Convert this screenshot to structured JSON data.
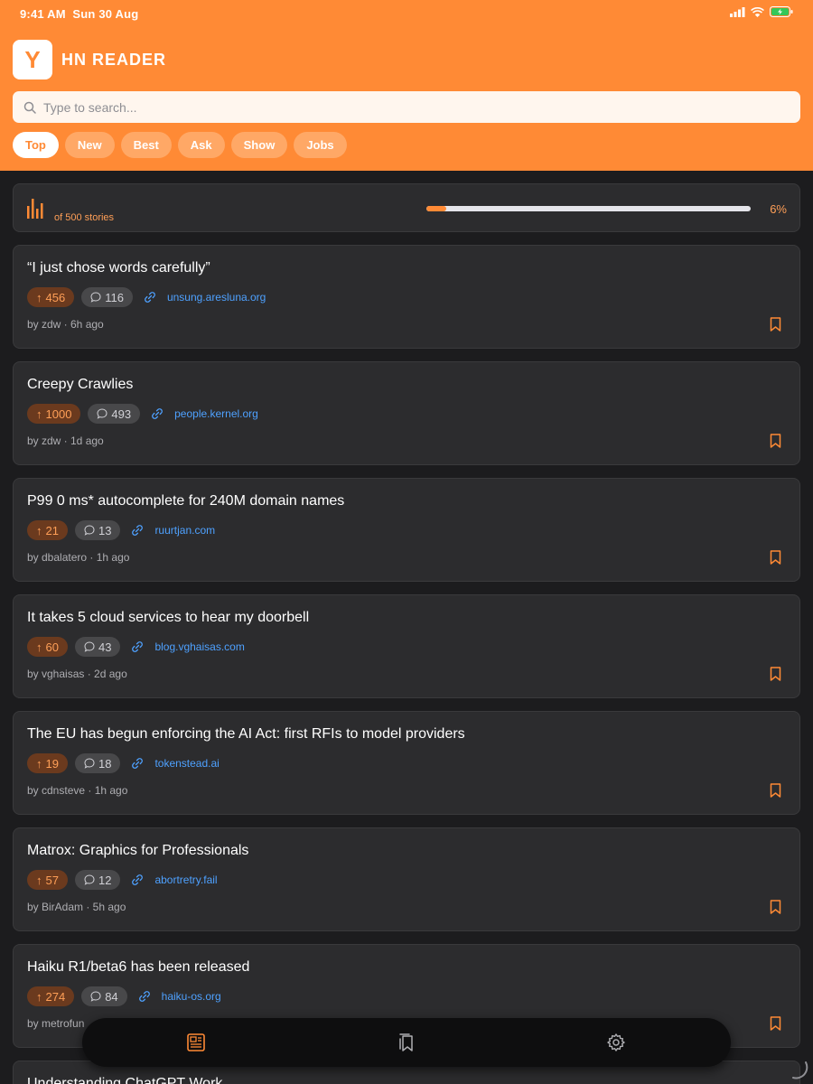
{
  "status_bar": {
    "time": "9:41 AM",
    "date": "Sun 30 Aug"
  },
  "app": {
    "logo_letter": "Y",
    "title": "HN READER"
  },
  "search": {
    "placeholder": "Type to search..."
  },
  "tabs": [
    {
      "label": "Top",
      "active": true
    },
    {
      "label": "New",
      "active": false
    },
    {
      "label": "Best",
      "active": false
    },
    {
      "label": "Ask",
      "active": false
    },
    {
      "label": "Show",
      "active": false
    },
    {
      "label": "Jobs",
      "active": false
    }
  ],
  "progress": {
    "caption": "of 500 stories",
    "percent_label": "6%",
    "fraction": 0.06
  },
  "stories": [
    {
      "title": "“I just chose words carefully”",
      "score": "456",
      "comments": "116",
      "domain": "unsung.aresluna.org",
      "byline": "by zdw · 6h ago"
    },
    {
      "title": "Creepy Crawlies",
      "score": "1000",
      "comments": "493",
      "domain": "people.kernel.org",
      "byline": "by zdw · 1d ago"
    },
    {
      "title": "P99 0 ms* autocomplete for 240M domain names",
      "score": "21",
      "comments": "13",
      "domain": "ruurtjan.com",
      "byline": "by dbalatero · 1h ago"
    },
    {
      "title": "It takes 5 cloud services to hear my doorbell",
      "score": "60",
      "comments": "43",
      "domain": "blog.vghaisas.com",
      "byline": "by vghaisas · 2d ago"
    },
    {
      "title": "The EU has begun enforcing the AI Act: first RFIs to model providers",
      "score": "19",
      "comments": "18",
      "domain": "tokenstead.ai",
      "byline": "by cdnsteve · 1h ago"
    },
    {
      "title": "Matrox: Graphics for Professionals",
      "score": "57",
      "comments": "12",
      "domain": "abortretry.fail",
      "byline": "by BirAdam · 5h ago"
    },
    {
      "title": "Haiku R1/beta6 has been released",
      "score": "274",
      "comments": "84",
      "domain": "haiku-os.org",
      "byline": "by metrofun"
    },
    {
      "title": "Understanding ChatGPT Work",
      "score": "",
      "comments": "",
      "domain": "",
      "byline": ""
    }
  ],
  "colors": {
    "accent": "#ff8a35",
    "background": "#1c1c1e",
    "card": "#2c2c2e",
    "link": "#4ea1ff"
  },
  "icons": {
    "tabbar": [
      "newspaper-icon",
      "bookmarks-icon",
      "gear-icon"
    ]
  }
}
